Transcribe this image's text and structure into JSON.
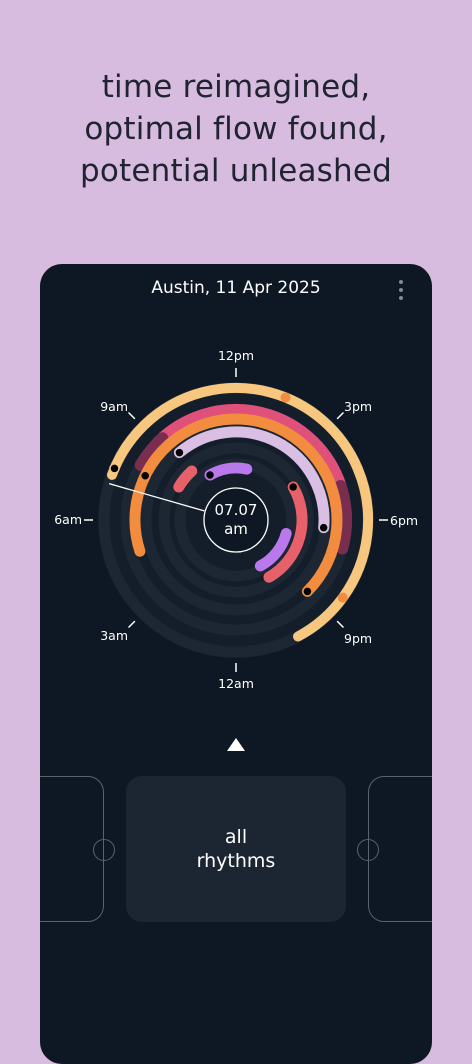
{
  "tagline": {
    "line1": "time reimagined,",
    "line2": "optimal flow found,",
    "line3": "potential unleashed"
  },
  "header": {
    "title": "Austin, 11 Apr 2025",
    "menu_icon": "vertical-dots-icon"
  },
  "clock": {
    "hour_labels": {
      "h12pm": "12pm",
      "h3pm": "3pm",
      "h6pm": "6pm",
      "h9pm": "9pm",
      "h12am": "12am",
      "h3am": "3am",
      "h6am": "6am",
      "h9am": "9am"
    },
    "current_time": "07.07",
    "current_period": "am",
    "colors": {
      "track": "#1c2733",
      "peach": "#f7c77f",
      "orange": "#f28c3f",
      "pink": "#df507a",
      "lavender": "#d9bfe3",
      "purple": "#b978ec",
      "coral": "#e8616a",
      "dark_pink": "#7a2e4f"
    }
  },
  "carousel": {
    "arrow_icon": "chevron-up-icon",
    "center_line1": "all",
    "center_line2": "rhythms"
  }
}
